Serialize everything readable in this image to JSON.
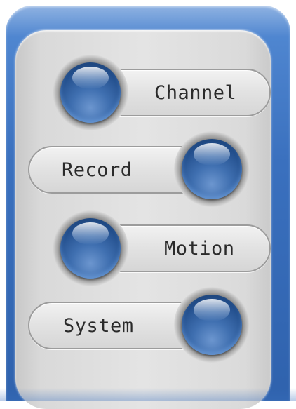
{
  "menu": {
    "items": [
      {
        "label": "Channel"
      },
      {
        "label": "Record"
      },
      {
        "label": "Motion"
      },
      {
        "label": "System"
      }
    ]
  },
  "colors": {
    "frame_blue": "#3a70be",
    "panel_gray": "#e0e0e0",
    "knob_blue": "#3f6fb0",
    "label_text": "#2a2a2a"
  },
  "icons": [
    "round-blue-button-icon"
  ]
}
